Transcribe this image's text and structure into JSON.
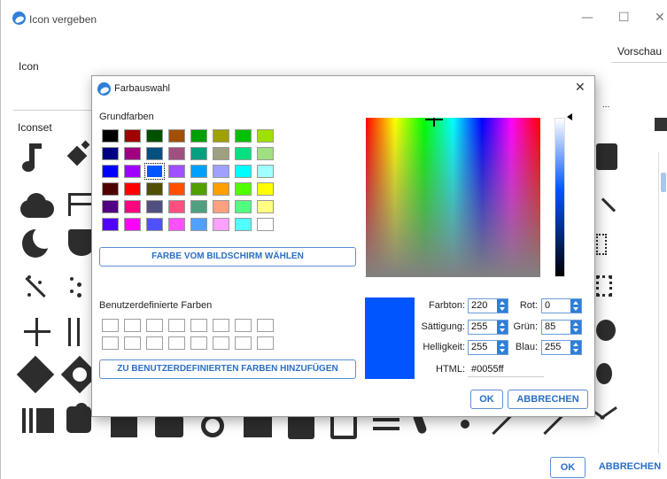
{
  "background": {
    "title": "Icon vergeben",
    "window_controls": {
      "minimize": "—",
      "maximize": "☐",
      "close": "✕"
    },
    "icon_label": "Icon",
    "iconset_label": "Iconset",
    "preview_label": "Vorschau",
    "ellipsis": "...",
    "ok_label": "OK",
    "cancel_label": "ABBRECHEN"
  },
  "dialog": {
    "title": "Farbauswahl",
    "close": "✕",
    "basic_colors_label": "Grundfarben",
    "basic_colors": [
      [
        "#000000",
        "#a00000",
        "#005000",
        "#a05000",
        "#00a000",
        "#a0a000",
        "#00c000",
        "#a0e000"
      ],
      [
        "#000080",
        "#a00080",
        "#005080",
        "#a05080",
        "#00a080",
        "#a0a080",
        "#00e080",
        "#a0e080"
      ],
      [
        "#0000ff",
        "#a000ff",
        "#0055ff",
        "#a050ff",
        "#00a0ff",
        "#a0a0ff",
        "#00ffff",
        "#a0ffff"
      ],
      [
        "#500000",
        "#ff0000",
        "#505000",
        "#ff5000",
        "#50a000",
        "#ffa000",
        "#50ff00",
        "#ffff00"
      ],
      [
        "#500080",
        "#ff0080",
        "#505080",
        "#ff5080",
        "#50a080",
        "#ffa080",
        "#50ff80",
        "#ffff80"
      ],
      [
        "#5000ff",
        "#ff00ff",
        "#5050ff",
        "#ff50ff",
        "#50a0ff",
        "#ffa0ff",
        "#50ffff",
        "#ffffff"
      ]
    ],
    "pick_screen_label": "FARBE VOM BILDSCHIRM WÄHLEN",
    "custom_colors_label": "Benutzerdefinierte Farben",
    "add_custom_label": "ZU BENUTZERDEFINIERTEN FARBEN HINZUFÜGEN",
    "current_color": "#0055ff",
    "fields": {
      "hue_label": "Farbton:",
      "hue": "220",
      "saturation_label": "Sättigung:",
      "saturation": "255",
      "value_label": "Helligkeit:",
      "value": "255",
      "red_label": "Rot:",
      "red": "0",
      "green_label": "Grün:",
      "green": "85",
      "blue_label": "Blau:",
      "blue": "255",
      "html_label": "HTML:",
      "html": "#0055ff"
    },
    "ok_label": "OK",
    "cancel_label": "ABBRECHEN"
  }
}
